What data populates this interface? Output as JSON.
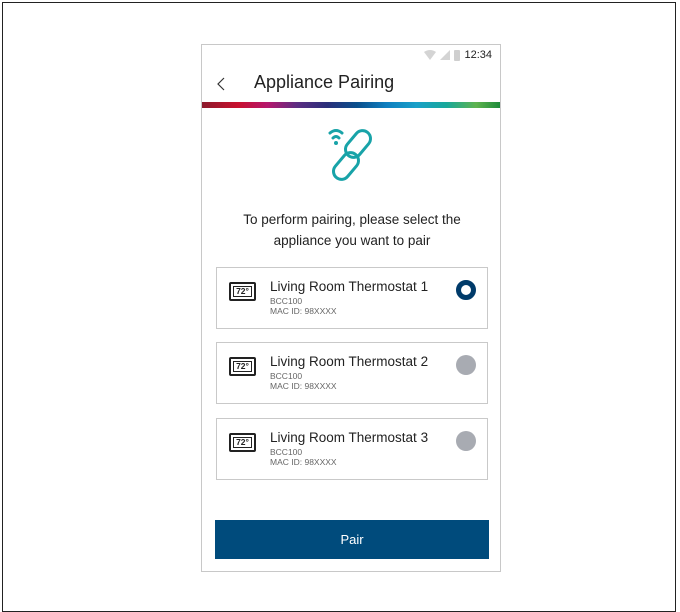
{
  "status_bar": {
    "time": "12:34",
    "icons": [
      "wifi-icon",
      "signal-icon",
      "battery-icon"
    ]
  },
  "header": {
    "back_icon": "chevron-left-icon",
    "title": "Appliance Pairing"
  },
  "hero": {
    "icon": "wireless-link-icon",
    "color": "#18a3a8"
  },
  "instructions": {
    "line1": "To perform pairing, please select the",
    "line2": "appliance you want to pair"
  },
  "devices": [
    {
      "icon_text": "72°",
      "name": "Living Room Thermostat 1",
      "model": "BCC100",
      "mac": "MAC ID: 98XXXX",
      "selected": true
    },
    {
      "icon_text": "72°",
      "name": "Living Room Thermostat 2",
      "model": "BCC100",
      "mac": "MAC ID: 98XXXX",
      "selected": false
    },
    {
      "icon_text": "72°",
      "name": "Living Room Thermostat 3",
      "model": "BCC100",
      "mac": "MAC ID: 98XXXX",
      "selected": false
    }
  ],
  "actions": {
    "pair_label": "Pair"
  },
  "colors": {
    "primary": "#004b7c",
    "selected_radio": "#003b6a",
    "unselected_radio": "#a8abb2"
  }
}
